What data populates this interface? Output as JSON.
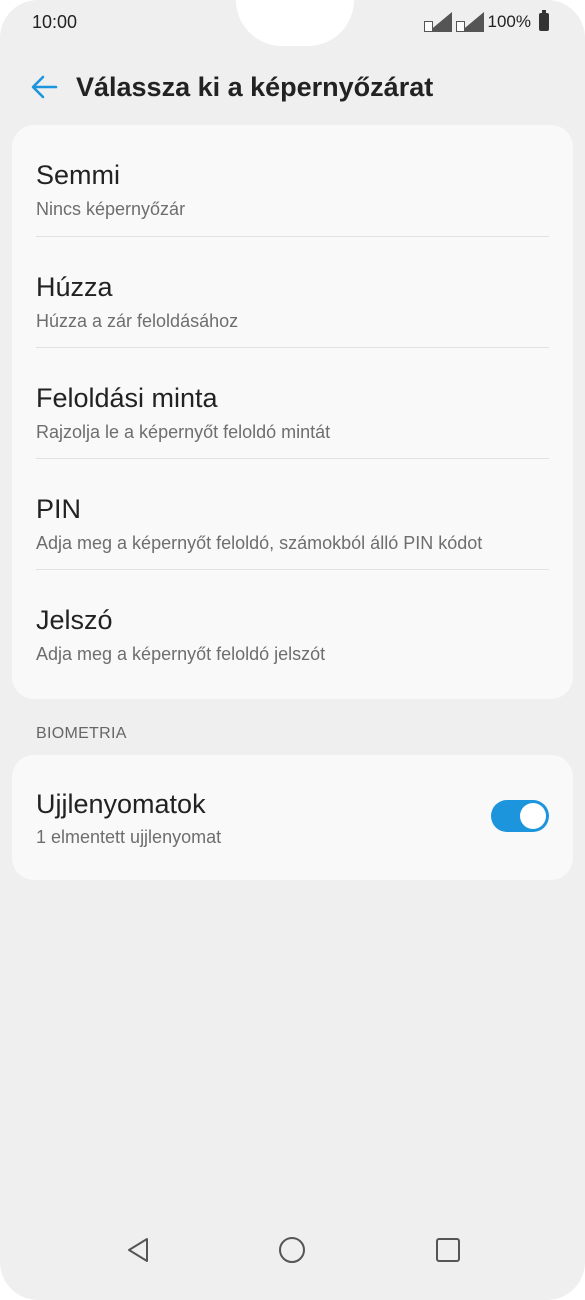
{
  "status_bar": {
    "time": "10:00",
    "battery": "100%"
  },
  "header": {
    "title": "Válassza ki a képernyőzárat",
    "back_icon": "arrow-left-icon"
  },
  "lock_options": [
    {
      "title": "Semmi",
      "subtitle": "Nincs képernyőzár"
    },
    {
      "title": "Húzza",
      "subtitle": "Húzza a zár feloldásához"
    },
    {
      "title": "Feloldási minta",
      "subtitle": "Rajzolja le a képernyőt feloldó mintát"
    },
    {
      "title": "PIN",
      "subtitle": "Adja meg a képernyőt feloldó, számokból álló PIN kódot"
    },
    {
      "title": "Jelszó",
      "subtitle": "Adja meg a képernyőt feloldó jelszót"
    }
  ],
  "biometrics": {
    "section_title": "BIOMETRIA",
    "item_title": "Ujjlenyomatok",
    "item_subtitle": "1 elmentett ujjlenyomat",
    "toggle_on": true
  },
  "colors": {
    "accent": "#1c95dd",
    "background": "#efefef",
    "card": "#f9f9f9"
  },
  "nav": {
    "back_icon": "triangle-back-icon",
    "home_icon": "circle-home-icon",
    "recent_icon": "square-recents-icon"
  }
}
